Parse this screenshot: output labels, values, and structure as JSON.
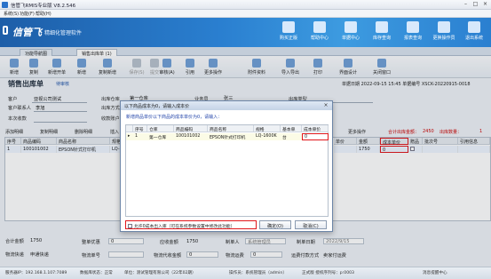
{
  "window": {
    "title": "信管飞RMIS专业版 V8.2.546"
  },
  "menu": [
    "系统(S)",
    "功能(F)",
    "帮助(H)"
  ],
  "brand": {
    "logo": "信管飞",
    "slogan": "精细化管理软件"
  },
  "top_buttons": [
    "购买正版",
    "帮助中心",
    "单据中心",
    "库存查询",
    "报表查询",
    "更换操作员",
    "退出系统"
  ],
  "tabs": [
    "功能导航图",
    "销售出库单 (1)"
  ],
  "toolbar": [
    "新增",
    "复制",
    "新增开单",
    "新增",
    "复制新增",
    "保存(S)",
    "提交",
    "审核(A)",
    "引用",
    "更多操作",
    "附件资料",
    "导入导出",
    "打印",
    "界面设计",
    "关闭窗口"
  ],
  "form": {
    "title": "销售出库单",
    "subtitle": "待审核",
    "date_label": "单据日期",
    "date": "2022-09-15 15:45",
    "voucher_label": "单据编号",
    "voucher": "XSCK-20220915-0018",
    "customer_label": "客户",
    "customer": "亚视公司测试",
    "warehouse_label": "出库仓库",
    "warehouse": "第一仓库",
    "department_label": "业务员",
    "department": "张三",
    "contact_label": "客户联系人",
    "contact": "李旭",
    "receive_label": "出库方式",
    "settle_label": "本次收款",
    "account_label": "收款账户",
    "type_label": "出库类型"
  },
  "detail_toolbar": [
    "添加明细",
    "复制明细",
    "删除明细",
    "插入",
    "更多操作"
  ],
  "detail_totals": {
    "total_amount_label": "合计出库金额：",
    "total_amount": "2450",
    "total_qty_label": "出库数量：",
    "total_qty": "1"
  },
  "grid": {
    "headers": [
      "序号",
      "商品编码",
      "商品名称",
      "规格",
      "单位",
      "数量",
      "单价",
      "金额",
      "赠品",
      "成本单价",
      "备注",
      "批次号",
      "引用信息"
    ],
    "rows": [
      {
        "no": "1",
        "code": "100101002",
        "name": "EPSON针式打印机",
        "spec": "LQ-1600K",
        "unit": "台",
        "qty": "1",
        "price": "",
        "amount": "1750",
        "gift": "",
        "cost": "0"
      }
    ]
  },
  "footer": {
    "total_label": "合计金额",
    "total": "1750",
    "discount_label": "整单优惠",
    "discount": "0",
    "receivable_label": "应收金额",
    "receivable": "1750",
    "operator_label": "制单人",
    "operator": "系统管理员",
    "make_date_label": "制单日期",
    "make_date": "2022/9/15",
    "freight_label": "物流快递",
    "freight": "申通快递",
    "tracking_label": "物流单号",
    "cost_label": "物流代收金额",
    "cost": "0",
    "fee_label": "物流运费",
    "fee": "0",
    "payer_label": "运费付款方式",
    "payer": "卖家付运费"
  },
  "statusbar": [
    "服务器IP：192.168.1.107:7089",
    "数据库状态：正常",
    "单位：测试管理有限公司（22年02期）",
    "操作员：系统管理员（admin）",
    "正式版 授权序列号：p:0003",
    "消息提醒中心"
  ],
  "dialog": {
    "title": "以下商品成本为0，请输入成本价",
    "hint": "新增商品单价以下商品的成本单价为0，请输入：",
    "headers": [
      "序号",
      "仓库",
      "商品编码",
      "商品名称",
      "规格",
      "基本单位",
      "成本单价"
    ],
    "rows": [
      {
        "no": "1",
        "warehouse": "第一仓库",
        "code": "100101002",
        "name": "EPSON针式打印机",
        "spec": "LQ-1600K",
        "unit": "台",
        "cost": "0"
      }
    ],
    "checkbox_label": "允许0成本出入库（可在系统参数设置中修改此功能）",
    "ok": "确定(O)",
    "cancel": "取消(C)"
  },
  "colors": {
    "banner": "#2a7fd0",
    "highlight": "#e0161b",
    "link": "#2244aa"
  }
}
